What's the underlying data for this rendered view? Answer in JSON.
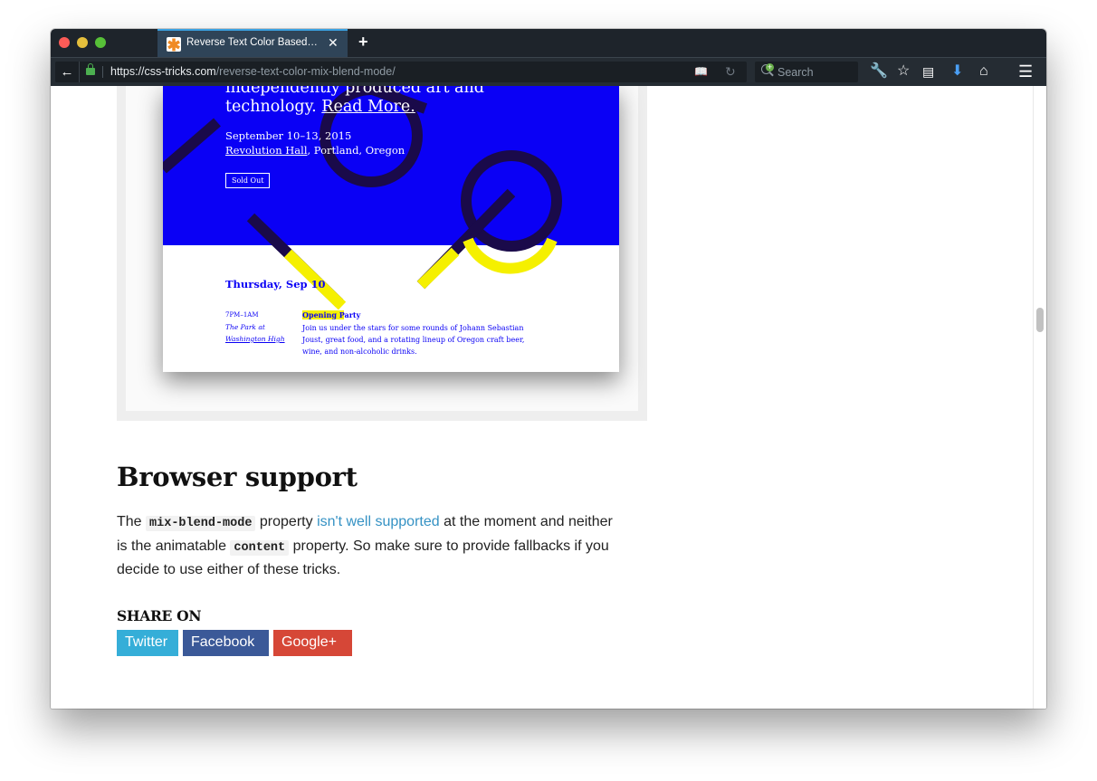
{
  "browser": {
    "tab": {
      "title": "Reverse Text Color Based o...",
      "favicon": "asterisk-favicon-icon",
      "close_label": "✕"
    },
    "new_tab_label": "+",
    "url": {
      "host": "https://css-tricks.com",
      "path": "/reverse-text-color-mix-blend-mode/"
    },
    "search_placeholder": "Search"
  },
  "figure": {
    "hero_line1": "independently produced art and",
    "hero_line2_prefix": "technology. ",
    "hero_link": "Read More.",
    "date": "September 10–13, 2015",
    "venue_link": "Revolution Hall",
    "venue_rest": ", Portland, Oregon",
    "sold_out": "Sold Out",
    "day": "Thursday, Sep 10",
    "time": "7PM–1AM",
    "place_line1": "The Park at",
    "place_line2": "Washington High",
    "event_title": "Opening Party",
    "event_desc": "Join us under the stars for some rounds of Johann Sebastian Joust, great food, and a rotating lineup of Oregon craft beer, wine, and non-alcoholic drinks.",
    "colors": {
      "hero": "#0a00f5",
      "accent": "#f5f000",
      "shape": "#1a0a4a"
    }
  },
  "article": {
    "heading": "Browser support",
    "p_the": "The",
    "code1": "mix-blend-mode",
    "p_property": "property",
    "link": "isn't well supported",
    "p_rest1": "at the moment and neither is the animatable",
    "code2": "content",
    "p_rest2": "property. So make sure to provide fallbacks if you decide to use either of these tricks."
  },
  "share": {
    "label": "SHARE ON",
    "buttons": [
      {
        "label": "Twitter",
        "color": "#35aed8"
      },
      {
        "label": "Facebook",
        "color": "#3b5998"
      },
      {
        "label": "Google+",
        "color": "#d64737"
      }
    ]
  }
}
